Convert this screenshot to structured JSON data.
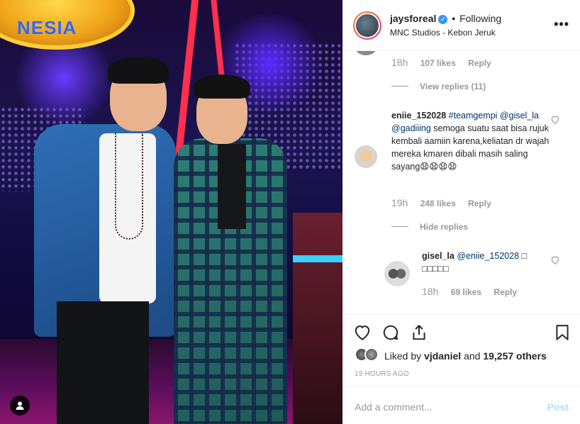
{
  "photo": {
    "sign_text": "NESIA",
    "profile_icon": "user-tag-icon"
  },
  "header": {
    "username": "jaysforeal",
    "verified_icon": "verified-badge-icon",
    "separator": "•",
    "follow_state": "Following",
    "location": "MNC Studios - Kebon Jeruk",
    "more_icon": "more-options-icon"
  },
  "comments": {
    "top_meta": {
      "time": "18h",
      "likes": "107 likes",
      "reply": "Reply"
    },
    "view_replies": "View replies (11)",
    "main_comment": {
      "user": "eniie_152028",
      "tags": [
        "#teamgempi",
        "@gisel_la",
        "@gadiiing"
      ],
      "body": "semoga suatu saat bisa rujuk kembali aamiin karena,keliatan dr wajah mereka kmaren dibali masih saling sayang😧😧😧😧",
      "time": "19h",
      "likes": "248 likes",
      "reply": "Reply"
    },
    "hide_replies": "Hide replies",
    "reply_comment": {
      "user": "gisel_la",
      "mention": "@eniie_152028",
      "body": "□ □□□□□",
      "time": "18h",
      "likes": "69 likes",
      "reply": "Reply"
    }
  },
  "actions": {
    "like_icon": "heart-icon",
    "comment_icon": "comment-icon",
    "share_icon": "share-icon",
    "save_icon": "bookmark-icon"
  },
  "likes_summary": {
    "prefix": "Liked by",
    "user": "vjdaniel",
    "middle": "and",
    "others": "19,257 others"
  },
  "posted_ago": "19 HOURS AGO",
  "add_comment": {
    "placeholder": "Add a comment...",
    "post_label": "Post"
  },
  "colors": {
    "link": "#003569",
    "verified": "#3897f0",
    "muted": "#999999",
    "post_disabled": "#b2dffc"
  }
}
